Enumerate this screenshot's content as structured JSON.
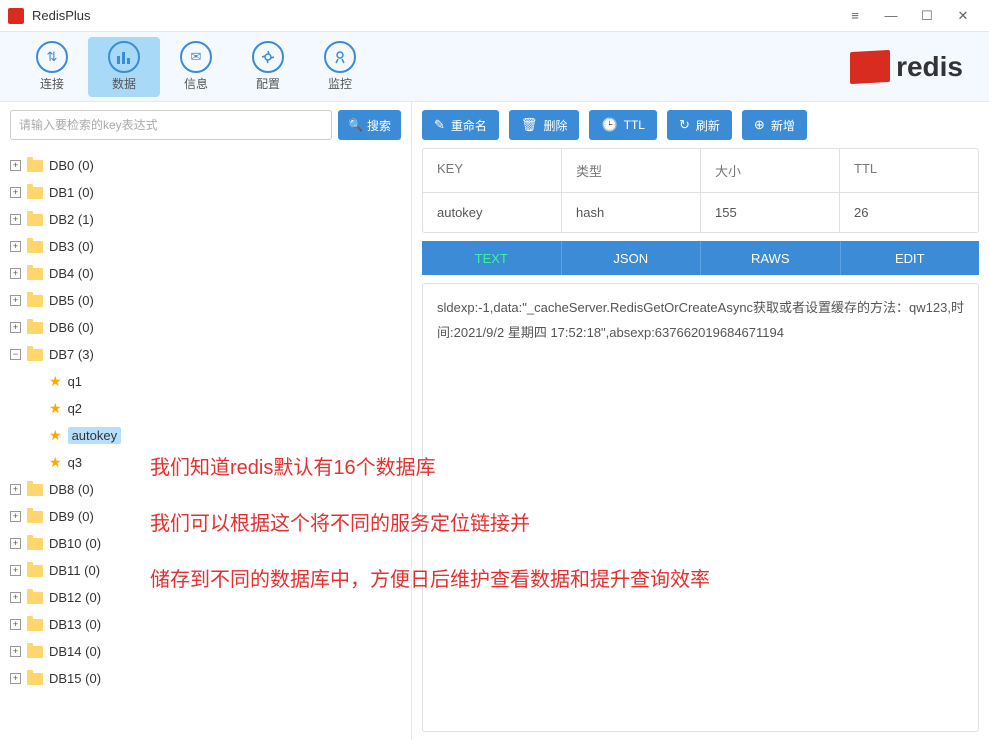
{
  "window": {
    "title": "RedisPlus"
  },
  "toolbar": {
    "items": [
      {
        "label": "连接"
      },
      {
        "label": "数据"
      },
      {
        "label": "信息"
      },
      {
        "label": "配置"
      },
      {
        "label": "监控"
      }
    ],
    "active_index": 1,
    "brand": "redis"
  },
  "search": {
    "placeholder": "请输入要检索的key表达式",
    "button": "搜索"
  },
  "tree": {
    "databases": [
      {
        "name": "DB0 (0)",
        "expanded": false
      },
      {
        "name": "DB1 (0)",
        "expanded": false
      },
      {
        "name": "DB2 (1)",
        "expanded": false
      },
      {
        "name": "DB3 (0)",
        "expanded": false
      },
      {
        "name": "DB4 (0)",
        "expanded": false
      },
      {
        "name": "DB5 (0)",
        "expanded": false
      },
      {
        "name": "DB6 (0)",
        "expanded": false
      },
      {
        "name": "DB7 (3)",
        "expanded": true,
        "children": [
          {
            "name": "q1"
          },
          {
            "name": "q2"
          },
          {
            "name": "autokey",
            "selected": true
          },
          {
            "name": "q3"
          }
        ]
      },
      {
        "name": "DB8 (0)",
        "expanded": false
      },
      {
        "name": "DB9 (0)",
        "expanded": false
      },
      {
        "name": "DB10 (0)",
        "expanded": false
      },
      {
        "name": "DB11 (0)",
        "expanded": false
      },
      {
        "name": "DB12 (0)",
        "expanded": false
      },
      {
        "name": "DB13 (0)",
        "expanded": false
      },
      {
        "name": "DB14 (0)",
        "expanded": false
      },
      {
        "name": "DB15 (0)",
        "expanded": false
      }
    ]
  },
  "actions": {
    "rename": "重命名",
    "delete": "删除",
    "ttl": "TTL",
    "refresh": "刷新",
    "add": "新增"
  },
  "key_info": {
    "headers": {
      "key": "KEY",
      "type": "类型",
      "size": "大小",
      "ttl": "TTL"
    },
    "values": {
      "key": "autokey",
      "type": "hash",
      "size": "155",
      "ttl": "26"
    }
  },
  "tabs": {
    "items": [
      "TEXT",
      "JSON",
      "RAWS",
      "EDIT"
    ],
    "active_index": 0
  },
  "content_text": "sldexp:-1,data:\"_cacheServer.RedisGetOrCreateAsync获取或者设置缓存的方法：qw123,时间:2021/9/2 星期四 17:52:18\",absexp:637662019684671194",
  "annotation": {
    "line1": "我们知道redis默认有16个数据库",
    "line2": "我们可以根据这个将不同的服务定位链接并",
    "line3": "储存到不同的数据库中，方便日后维护查看数据和提升查询效率"
  }
}
